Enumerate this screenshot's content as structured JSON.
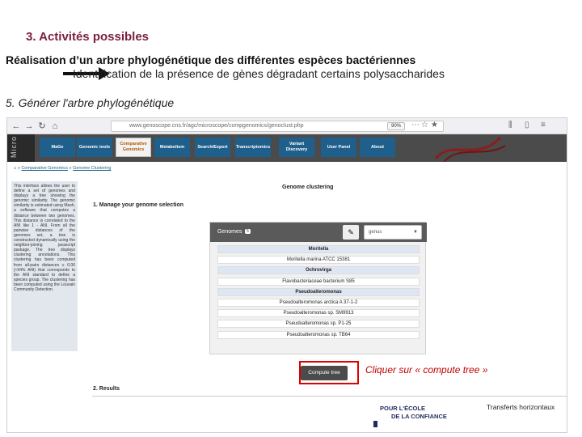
{
  "slide": {
    "title": "3. Activités possibles",
    "headline": "Réalisation d’un arbre phylogénétique des différentes espèces bactériennes",
    "subline": "Identification de la présence de gènes dégradant certains polysaccharides",
    "step": "5. Générer l'arbre phylogénétique",
    "annotation": "Cliquer sur « compute tree »",
    "corner_label": "Transferts horizontaux",
    "footer_logo_line1": "POUR L'ÉCOLE",
    "footer_logo_line2": "DE LA CONFIANCE",
    "colors": {
      "title": "#7a1f3d",
      "annotation": "#c00000",
      "highlight_box": "#e00000"
    }
  },
  "browser": {
    "url": "www.genoscope.cns.fr/agc/microscope/compgenomics/genoclust.php",
    "zoom": "90%"
  },
  "site": {
    "logo_text": "Micro",
    "nav": [
      "MaGe",
      "Genomic tools",
      "Comparative Genomics",
      "Metabolism",
      "Search/Export",
      "Transcriptomics",
      "Variant Discovery",
      "User Panel",
      "About"
    ]
  },
  "breadcrumb": {
    "root": "Comparative Genomics",
    "separator": "»",
    "current": "Genome Clustering"
  },
  "help_icon": "?",
  "sidebar": {
    "text": "This interface allows the user to define a set of genomes and displays a tree showing the genomic similarity. The genomic similarity is estimated using Mash, a software that computes a distance between two genomes. This distance is correlated to the ANI like 1 - ANI. From all the pairwise distances of the genomes set, a tree is constructed dynamically using the neighbor-joining javascript package. The tree displays clustering annotations. This clustering has been computed from all-pairs distances ≤ 0.06 (≈94% ANI) that corresponds to the ANI standard to define a species group. The clustering has been computed using the Louvain Community Detection."
  },
  "main": {
    "title": "Genome clustering",
    "section1": "1. Manage your genome selection",
    "genomes_label": "Genomes",
    "genomes_count": "5",
    "rank_select": "genus",
    "genome_rows": [
      {
        "label": "Moritella",
        "group": true
      },
      {
        "label": "Moritella marina ATCC 15381",
        "group": false
      },
      {
        "label": "Ochrovirga",
        "group": true
      },
      {
        "label": "Flavobacteriaceae bacterium S85",
        "group": false
      },
      {
        "label": "Pseudoalteromonas",
        "group": true
      },
      {
        "label": "Pseudoalteromonas arctica A 37-1-2",
        "group": false
      },
      {
        "label": "Pseudoalteromonas sp. SM9913",
        "group": false
      },
      {
        "label": "Pseudoalteromonas sp. P1-25",
        "group": false
      },
      {
        "label": "Pseudoalteromonas sp. TB64",
        "group": false
      }
    ],
    "compute_button": "Compute tree",
    "section2": "2. Results"
  }
}
